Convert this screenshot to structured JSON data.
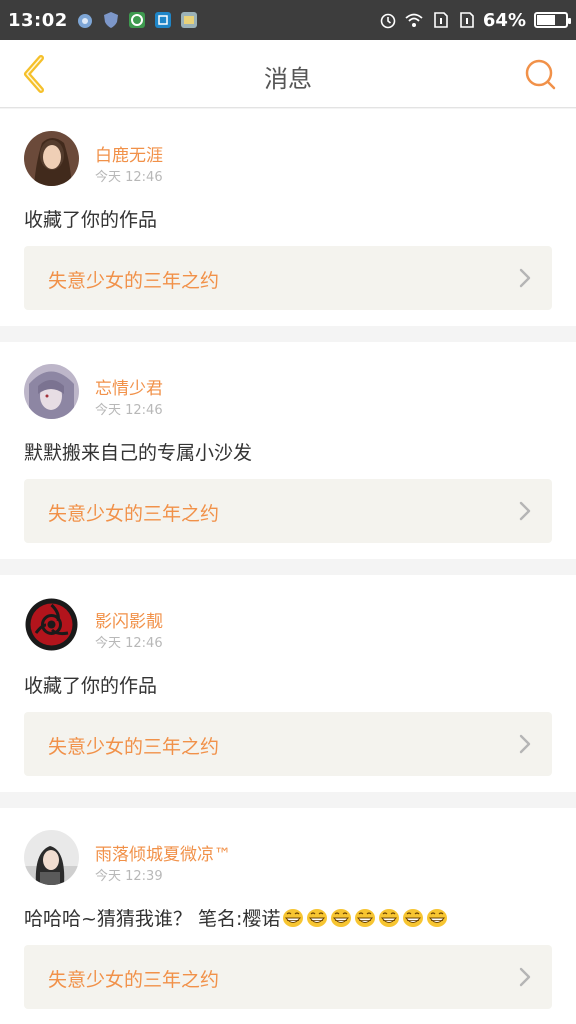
{
  "status": {
    "time": "13:02",
    "battery_text": "64%",
    "battery_level": 0.64
  },
  "nav": {
    "title": "消息"
  },
  "messages": [
    {
      "user": "白鹿无涯",
      "time": "今天 12:46",
      "text": "收藏了你的作品",
      "work_title": "失意少女的三年之约",
      "emoji_count": 0
    },
    {
      "user": "忘情少君",
      "time": "今天 12:46",
      "text": "默默搬来自己的专属小沙发",
      "work_title": "失意少女的三年之约",
      "emoji_count": 0
    },
    {
      "user": "影闪影靓",
      "time": "今天 12:46",
      "text": "收藏了你的作品",
      "work_title": "失意少女的三年之约",
      "emoji_count": 0
    },
    {
      "user": "雨落倾城夏微凉™",
      "time": "今天 12:39",
      "text": "哈哈哈~猜猜我谁？ 笔名:樱诺",
      "work_title": "失意少女的三年之约",
      "emoji_count": 7
    }
  ],
  "colors": {
    "accent": "#f19149",
    "back_arrow": "#f5c02b"
  },
  "icons": {
    "back": "chevron-left-icon",
    "search": "search-icon",
    "work_chevron": "chevron-right-icon",
    "emoji": "grinning-face-icon"
  }
}
